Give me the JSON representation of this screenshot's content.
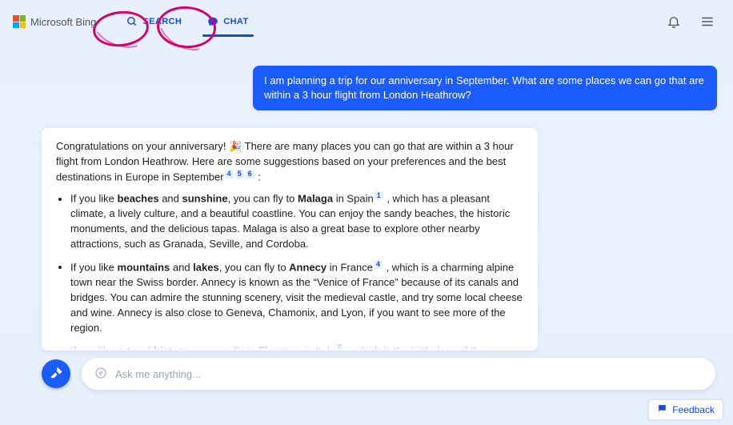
{
  "brand": "Microsoft Bing",
  "tabs": {
    "search": "SEARCH",
    "chat": "CHAT"
  },
  "user_message": "I am planning a trip for our anniversary in September. What are some places we can go that are within a 3 hour flight from London Heathrow?",
  "bot": {
    "intro_a": "Congratulations on your anniversary! ",
    "emoji": "🎉",
    "intro_b": " There are many places you can go that are within a 3 hour flight from London Heathrow. Here are some suggestions based on your preferences and the best destinations in Europe in September",
    "intro_cites": [
      "4",
      "5",
      "6"
    ],
    "colon": " :",
    "items": [
      {
        "pre": "If you like ",
        "b1": "beaches",
        "mid1": " and ",
        "b2": "sunshine",
        "mid2": ", you can fly to ",
        "b3": "Malaga",
        "post1": " in Spain",
        "cite": "1",
        "post2": " , which has a pleasant climate, a lively culture, and a beautiful coastline. You can enjoy the sandy beaches, the historic monuments, and the delicious tapas. Malaga is also a great base to explore other nearby attractions, such as Granada, Seville, and Cordoba."
      },
      {
        "pre": "If you like ",
        "b1": "mountains",
        "mid1": " and ",
        "b2": "lakes",
        "mid2": ", you can fly to ",
        "b3": "Annecy",
        "post1": " in France",
        "cite": "4",
        "post2": " , which is a charming alpine town near the Swiss border. Annecy is known as the “Venice of France” because of its canals and bridges. You can admire the stunning scenery, visit the medieval castle, and try some local cheese and wine. Annecy is also close to Geneva, Chamonix, and Lyon, if you want to see more of the region."
      },
      {
        "pre": "If you like ",
        "b1": "art",
        "mid1": " and ",
        "b2": "history",
        "mid2": ", you can fly to ",
        "b3": "Florence",
        "post1": " in Italy",
        "cite": "6",
        "post2": " , which is the birthplace of the Renaissance and a UNESCO World Heritage Site. Florence is a treasure trove of artistic and architectural masterpieces, such as the Duomo, the Uffizi Gallery, and the Ponte Vecchio. You can also explore the Tuscan countryside, taste the famous gelato, and shop for leather goods."
      }
    ]
  },
  "input": {
    "placeholder": "Ask me anything..."
  },
  "feedback": "Feedback"
}
